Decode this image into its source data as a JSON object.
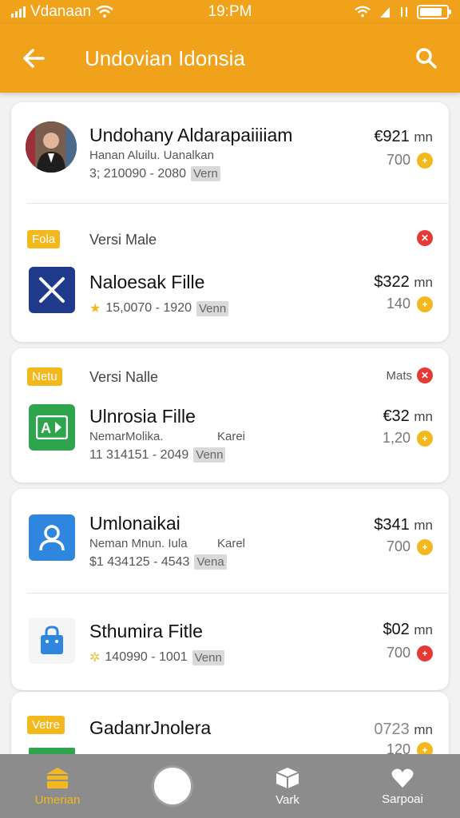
{
  "status": {
    "carrier": "Vdanaan",
    "time": "19:PM",
    "battery_level": 0.85
  },
  "header": {
    "title": "Undovian Idonsia"
  },
  "items": [
    {
      "name": "Undohany Aldarapaiiiiam",
      "sub": "Hanan Aluilu. Uanalkan",
      "meta": "3; 210090 - 2080",
      "tag": "Vern",
      "price": "€921",
      "unit": "mn",
      "count": "700"
    },
    {
      "badge": "Fola",
      "label": "Versi Male",
      "name": "Naloesak Fille",
      "meta": "15,0070 - 1920",
      "tag": "Venn",
      "price": "$322",
      "unit": "mn",
      "count": "140"
    },
    {
      "badge": "Netu",
      "label": "Versi Nalle",
      "right_label": "Mats",
      "name": "Ulnrosia Fille",
      "sub": "NemarMolika.",
      "sub_right": "Karei",
      "meta": "11 314151 - 2049",
      "tag": "Venn",
      "price": "€32",
      "unit": "mn",
      "count": "1,20"
    },
    {
      "name": "Umlonaikai",
      "sub": "Neman Mnun. Iula",
      "sub_right": "Karel",
      "meta": "$1 434125 - 4543",
      "tag": "Vena",
      "price": "$341",
      "unit": "mn",
      "count": "700"
    },
    {
      "name": "Sthumira Fitle",
      "meta": "140990 - 1001",
      "tag": "Venn",
      "price": "$02",
      "unit": "mn",
      "count": "700"
    },
    {
      "badge": "Vetre",
      "name": "GadanrJnolera",
      "price": "0723",
      "unit": "mn",
      "count": "120"
    }
  ],
  "nav": [
    {
      "label": "Umerian",
      "icon": "store-icon"
    },
    {
      "label": "",
      "icon": "home-button"
    },
    {
      "label": "Vark",
      "icon": "box-icon"
    },
    {
      "label": "Sarpoai",
      "icon": "heart-icon"
    }
  ],
  "colors": {
    "accent": "#f0a21b",
    "gold": "#f2b81c",
    "red": "#e53935",
    "nav_bg": "#8c8c8c"
  }
}
